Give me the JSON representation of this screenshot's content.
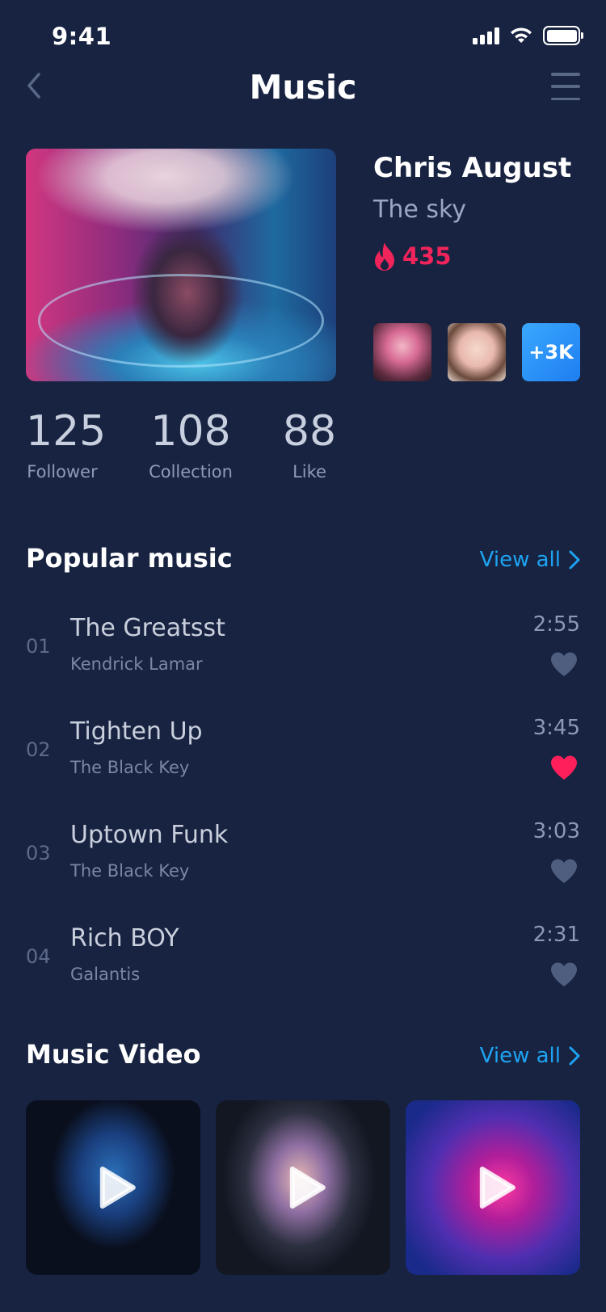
{
  "status_bar": {
    "time": "9:41"
  },
  "nav": {
    "title": "Music"
  },
  "artist": {
    "name": "Chris August",
    "song": "The sky",
    "hot_count": "435",
    "fans_more": "+3K"
  },
  "stats": [
    {
      "value": "125",
      "label": "Follower"
    },
    {
      "value": "108",
      "label": "Collection"
    },
    {
      "value": "88",
      "label": "Like"
    }
  ],
  "popular": {
    "title": "Popular music",
    "view_all": "View all",
    "tracks": [
      {
        "num": "01",
        "title": "The Greatsst",
        "artist": "Kendrick Lamar",
        "time": "2:55",
        "liked": false
      },
      {
        "num": "02",
        "title": "Tighten Up",
        "artist": "The Black Key",
        "time": "3:45",
        "liked": true
      },
      {
        "num": "03",
        "title": "Uptown Funk",
        "artist": "The Black Key",
        "time": "3:03",
        "liked": false
      },
      {
        "num": "04",
        "title": "Rich BOY",
        "artist": "Galantis",
        "time": "2:31",
        "liked": false
      }
    ]
  },
  "videos": {
    "title": "Music Video",
    "view_all": "View all"
  },
  "colors": {
    "background": "#172341",
    "accent": "#1ea3f2",
    "hot": "#f0245a",
    "heart_liked": "#ff1f5a",
    "heart_default": "#4f5d7e"
  }
}
